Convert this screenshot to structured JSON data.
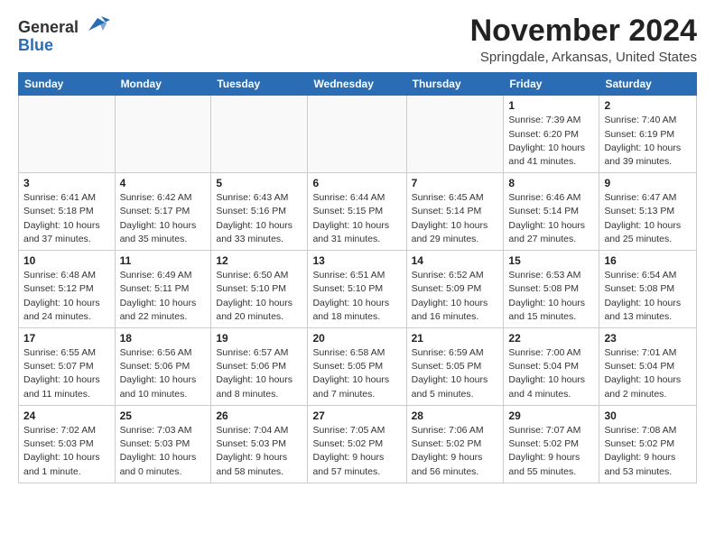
{
  "header": {
    "logo_general": "General",
    "logo_blue": "Blue",
    "month": "November 2024",
    "location": "Springdale, Arkansas, United States"
  },
  "weekdays": [
    "Sunday",
    "Monday",
    "Tuesday",
    "Wednesday",
    "Thursday",
    "Friday",
    "Saturday"
  ],
  "weeks": [
    [
      {
        "day": "",
        "info": ""
      },
      {
        "day": "",
        "info": ""
      },
      {
        "day": "",
        "info": ""
      },
      {
        "day": "",
        "info": ""
      },
      {
        "day": "",
        "info": ""
      },
      {
        "day": "1",
        "info": "Sunrise: 7:39 AM\nSunset: 6:20 PM\nDaylight: 10 hours\nand 41 minutes."
      },
      {
        "day": "2",
        "info": "Sunrise: 7:40 AM\nSunset: 6:19 PM\nDaylight: 10 hours\nand 39 minutes."
      }
    ],
    [
      {
        "day": "3",
        "info": "Sunrise: 6:41 AM\nSunset: 5:18 PM\nDaylight: 10 hours\nand 37 minutes."
      },
      {
        "day": "4",
        "info": "Sunrise: 6:42 AM\nSunset: 5:17 PM\nDaylight: 10 hours\nand 35 minutes."
      },
      {
        "day": "5",
        "info": "Sunrise: 6:43 AM\nSunset: 5:16 PM\nDaylight: 10 hours\nand 33 minutes."
      },
      {
        "day": "6",
        "info": "Sunrise: 6:44 AM\nSunset: 5:15 PM\nDaylight: 10 hours\nand 31 minutes."
      },
      {
        "day": "7",
        "info": "Sunrise: 6:45 AM\nSunset: 5:14 PM\nDaylight: 10 hours\nand 29 minutes."
      },
      {
        "day": "8",
        "info": "Sunrise: 6:46 AM\nSunset: 5:14 PM\nDaylight: 10 hours\nand 27 minutes."
      },
      {
        "day": "9",
        "info": "Sunrise: 6:47 AM\nSunset: 5:13 PM\nDaylight: 10 hours\nand 25 minutes."
      }
    ],
    [
      {
        "day": "10",
        "info": "Sunrise: 6:48 AM\nSunset: 5:12 PM\nDaylight: 10 hours\nand 24 minutes."
      },
      {
        "day": "11",
        "info": "Sunrise: 6:49 AM\nSunset: 5:11 PM\nDaylight: 10 hours\nand 22 minutes."
      },
      {
        "day": "12",
        "info": "Sunrise: 6:50 AM\nSunset: 5:10 PM\nDaylight: 10 hours\nand 20 minutes."
      },
      {
        "day": "13",
        "info": "Sunrise: 6:51 AM\nSunset: 5:10 PM\nDaylight: 10 hours\nand 18 minutes."
      },
      {
        "day": "14",
        "info": "Sunrise: 6:52 AM\nSunset: 5:09 PM\nDaylight: 10 hours\nand 16 minutes."
      },
      {
        "day": "15",
        "info": "Sunrise: 6:53 AM\nSunset: 5:08 PM\nDaylight: 10 hours\nand 15 minutes."
      },
      {
        "day": "16",
        "info": "Sunrise: 6:54 AM\nSunset: 5:08 PM\nDaylight: 10 hours\nand 13 minutes."
      }
    ],
    [
      {
        "day": "17",
        "info": "Sunrise: 6:55 AM\nSunset: 5:07 PM\nDaylight: 10 hours\nand 11 minutes."
      },
      {
        "day": "18",
        "info": "Sunrise: 6:56 AM\nSunset: 5:06 PM\nDaylight: 10 hours\nand 10 minutes."
      },
      {
        "day": "19",
        "info": "Sunrise: 6:57 AM\nSunset: 5:06 PM\nDaylight: 10 hours\nand 8 minutes."
      },
      {
        "day": "20",
        "info": "Sunrise: 6:58 AM\nSunset: 5:05 PM\nDaylight: 10 hours\nand 7 minutes."
      },
      {
        "day": "21",
        "info": "Sunrise: 6:59 AM\nSunset: 5:05 PM\nDaylight: 10 hours\nand 5 minutes."
      },
      {
        "day": "22",
        "info": "Sunrise: 7:00 AM\nSunset: 5:04 PM\nDaylight: 10 hours\nand 4 minutes."
      },
      {
        "day": "23",
        "info": "Sunrise: 7:01 AM\nSunset: 5:04 PM\nDaylight: 10 hours\nand 2 minutes."
      }
    ],
    [
      {
        "day": "24",
        "info": "Sunrise: 7:02 AM\nSunset: 5:03 PM\nDaylight: 10 hours\nand 1 minute."
      },
      {
        "day": "25",
        "info": "Sunrise: 7:03 AM\nSunset: 5:03 PM\nDaylight: 10 hours\nand 0 minutes."
      },
      {
        "day": "26",
        "info": "Sunrise: 7:04 AM\nSunset: 5:03 PM\nDaylight: 9 hours\nand 58 minutes."
      },
      {
        "day": "27",
        "info": "Sunrise: 7:05 AM\nSunset: 5:02 PM\nDaylight: 9 hours\nand 57 minutes."
      },
      {
        "day": "28",
        "info": "Sunrise: 7:06 AM\nSunset: 5:02 PM\nDaylight: 9 hours\nand 56 minutes."
      },
      {
        "day": "29",
        "info": "Sunrise: 7:07 AM\nSunset: 5:02 PM\nDaylight: 9 hours\nand 55 minutes."
      },
      {
        "day": "30",
        "info": "Sunrise: 7:08 AM\nSunset: 5:02 PM\nDaylight: 9 hours\nand 53 minutes."
      }
    ]
  ]
}
